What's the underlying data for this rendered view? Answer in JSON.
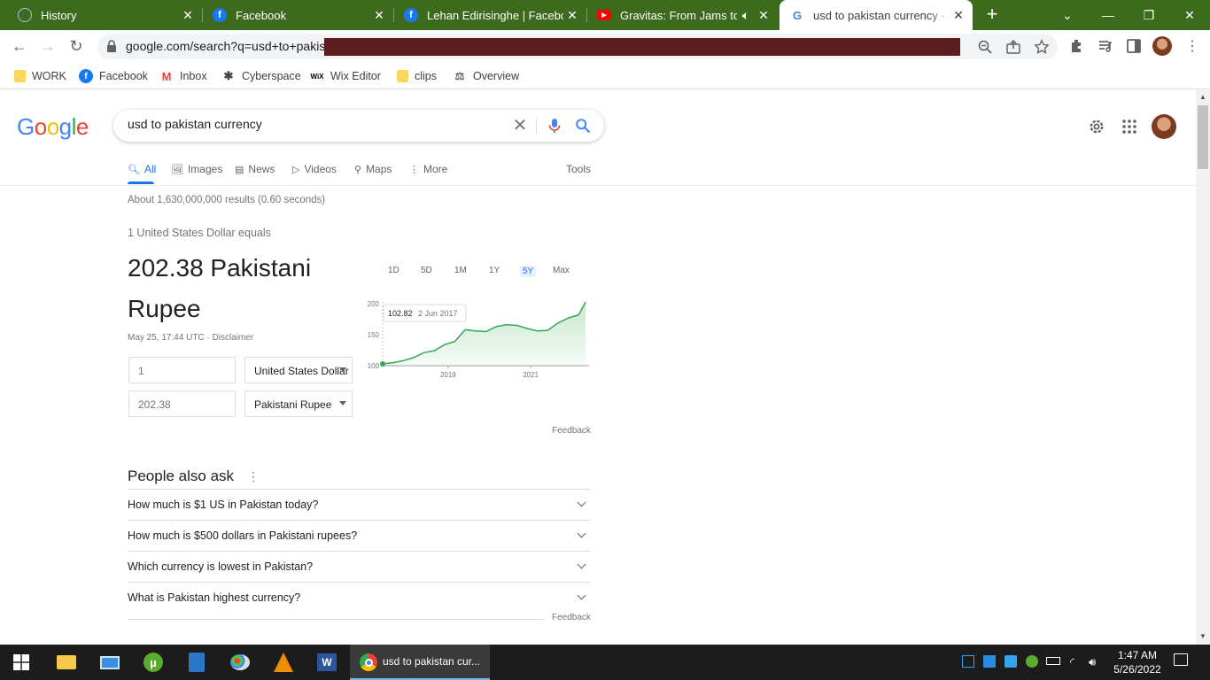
{
  "browser": {
    "tabs": [
      {
        "label": "History",
        "icon": "history-icon"
      },
      {
        "label": "Facebook",
        "icon": "facebook-icon"
      },
      {
        "label": "Lehan Edirisinghe | Facebook",
        "icon": "facebook-icon"
      },
      {
        "label": "Gravitas: From Jams to T",
        "icon": "youtube-icon"
      },
      {
        "label": "usd to pakistan currency - G",
        "icon": "google-icon"
      }
    ],
    "url": "google.com/search?q=usd+to+pakis",
    "bookmarks": [
      {
        "label": "WORK"
      },
      {
        "label": "Facebook"
      },
      {
        "label": "Inbox"
      },
      {
        "label": "Cyberspace"
      },
      {
        "label": "Wix Editor"
      },
      {
        "label": "clips"
      },
      {
        "label": "Overview"
      }
    ]
  },
  "google": {
    "logo": "Google",
    "query": "usd to pakistan currency",
    "tabs": [
      {
        "label": "All"
      },
      {
        "label": "Images"
      },
      {
        "label": "News"
      },
      {
        "label": "Videos"
      },
      {
        "label": "Maps"
      },
      {
        "label": "More"
      }
    ],
    "tools": "Tools",
    "stats": "About 1,630,000,000 results (0.60 seconds)"
  },
  "converter": {
    "equals": "1 United States Dollar equals",
    "result": "202.38 Pakistani Rupee",
    "dateline": "May 25, 17:44 UTC · Disclaimer",
    "from_value": "1",
    "from_currency": "United States Dollar",
    "to_value": "202.38",
    "to_currency": "Pakistani Rupee",
    "ranges": [
      "1D",
      "5D",
      "1M",
      "1Y",
      "5Y",
      "Max"
    ],
    "active_range": "5Y",
    "feedback": "Feedback"
  },
  "chart_data": {
    "type": "area",
    "x": [
      "2017-06",
      "2017-09",
      "2017-12",
      "2018-03",
      "2018-06",
      "2018-09",
      "2018-12",
      "2019-03",
      "2019-06",
      "2019-09",
      "2019-12",
      "2020-03",
      "2020-06",
      "2020-09",
      "2020-12",
      "2021-03",
      "2021-06",
      "2021-09",
      "2021-12",
      "2022-03",
      "2022-05"
    ],
    "values": [
      102.82,
      104.8,
      108,
      113,
      121,
      124,
      134,
      139,
      158,
      156,
      155,
      163,
      166,
      165,
      160,
      156,
      157,
      169,
      177,
      182,
      202.38
    ],
    "yticks": [
      100,
      150,
      200
    ],
    "xticks": [
      "2019",
      "2021"
    ],
    "ylim": [
      100,
      200
    ],
    "tooltip_value": "102.82",
    "tooltip_date": "2 Jun 2017",
    "color": "#34a853"
  },
  "paa": {
    "title": "People also ask",
    "questions": [
      "How much is $1 US in Pakistan today?",
      "How much is $500 dollars in Pakistani rupees?",
      "Which currency is lowest in Pakistan?",
      "What is Pakistan highest currency?"
    ],
    "feedback": "Feedback"
  },
  "taskbar": {
    "active_label": "usd to pakistan cur...",
    "time": "1:47 AM",
    "date": "5/26/2022"
  }
}
